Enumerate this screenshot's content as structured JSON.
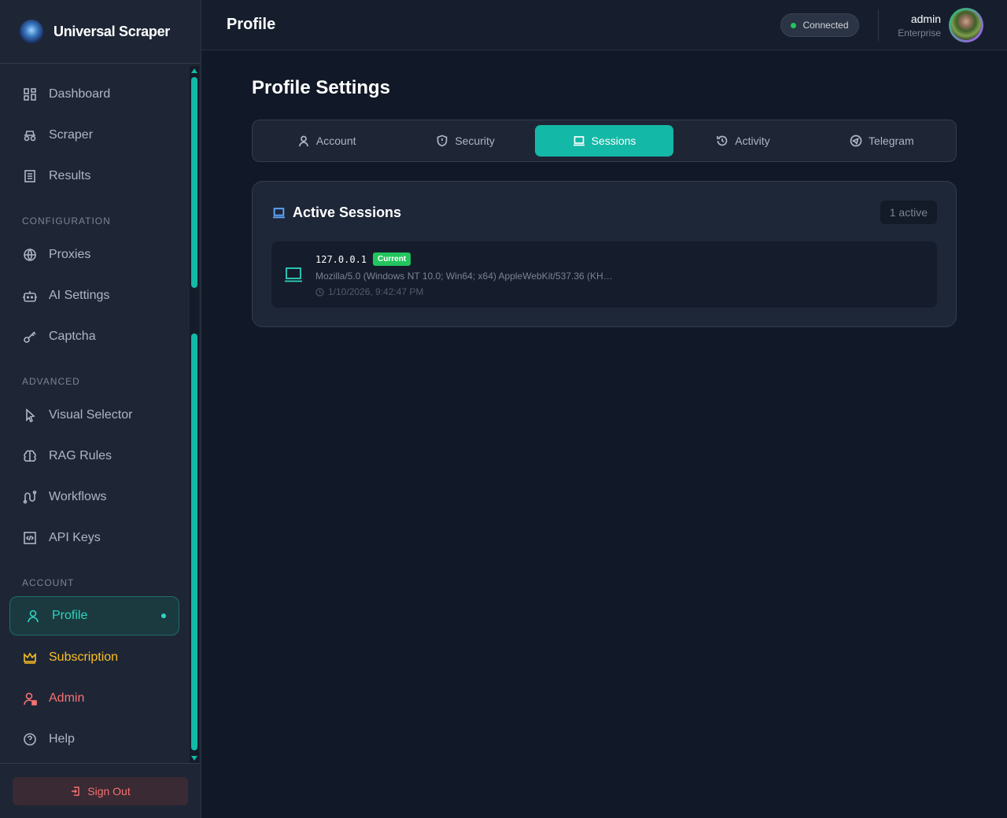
{
  "app": {
    "name": "Universal Scraper"
  },
  "sidebar": {
    "items": [
      {
        "label": "Dashboard"
      },
      {
        "label": "Scraper"
      },
      {
        "label": "Results"
      }
    ],
    "config_title": "CONFIGURATION",
    "config_items": [
      {
        "label": "Proxies"
      },
      {
        "label": "AI Settings"
      },
      {
        "label": "Captcha"
      }
    ],
    "advanced_title": "ADVANCED",
    "advanced_items": [
      {
        "label": "Visual Selector"
      },
      {
        "label": "RAG Rules"
      },
      {
        "label": "Workflows"
      },
      {
        "label": "API Keys"
      }
    ],
    "account_title": "ACCOUNT",
    "account_items": [
      {
        "label": "Profile"
      },
      {
        "label": "Subscription"
      },
      {
        "label": "Admin"
      },
      {
        "label": "Help"
      }
    ],
    "sign_out": "Sign Out"
  },
  "header": {
    "title": "Profile",
    "status": "Connected",
    "user": "admin",
    "role": "Enterprise"
  },
  "main": {
    "title": "Profile Settings",
    "tabs": [
      {
        "label": "Account"
      },
      {
        "label": "Security"
      },
      {
        "label": "Sessions"
      },
      {
        "label": "Activity"
      },
      {
        "label": "Telegram"
      }
    ],
    "active_tab": "Sessions",
    "sessions": {
      "title": "Active Sessions",
      "count": "1 active",
      "items": [
        {
          "ip": "127.0.0.1",
          "badge": "Current",
          "ua": "Mozilla/5.0 (Windows NT 10.0; Win64; x64) AppleWebKit/537.36 (KH…",
          "time": "1/10/2026, 9:42:47 PM"
        }
      ]
    }
  },
  "colors": {
    "accent": "#14b8a6",
    "subscription": "#fbbf24",
    "admin": "#f87171",
    "connected": "#22c55e"
  }
}
